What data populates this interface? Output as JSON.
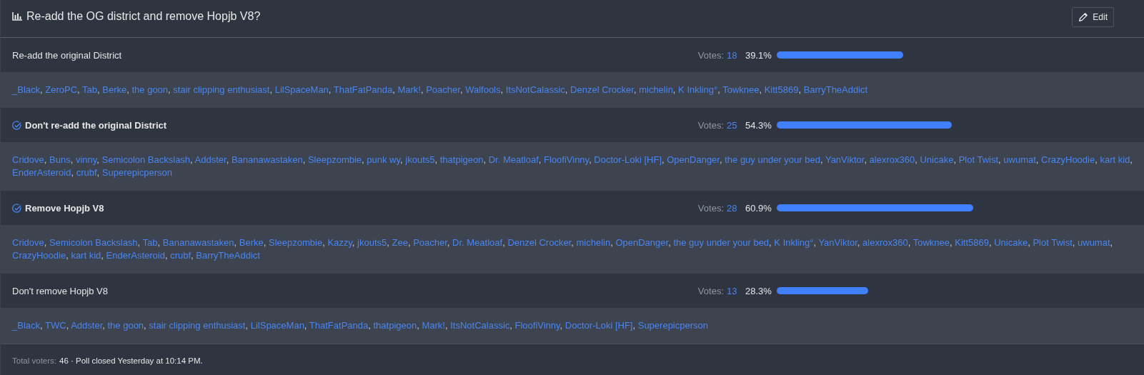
{
  "poll": {
    "title": "Re-add the OG district and remove Hopjb V8?",
    "edit_button": "Edit"
  },
  "options": [
    {
      "label": "Re-add the original District",
      "voted": false,
      "votes_label": "Votes:",
      "votes": "18",
      "percent": "39.1%",
      "voters": [
        "_Black",
        "ZeroPC",
        "Tab",
        "Berke",
        "the goon",
        "stair clipping enthusiast",
        "LilSpaceMan",
        "ThatFatPanda",
        "Mark!",
        "Poacher",
        "Walfools",
        "ItsNotCalassic",
        "Denzel Crocker",
        "michelin",
        "K Inkling°",
        "Towknee",
        "Kitt5869",
        "BarryTheAddict"
      ]
    },
    {
      "label": "Don't re-add the original District",
      "voted": true,
      "votes_label": "Votes:",
      "votes": "25",
      "percent": "54.3%",
      "voters": [
        "Cridove",
        "Buns",
        "vinny",
        "Semicolon Backslash",
        "Addster",
        "Bananawastaken",
        "Sleepzombie",
        "punk wy",
        "jkouts5",
        "thatpigeon",
        "Dr. Meatloaf",
        "FloofiVinny",
        "Doctor-Loki [HF]",
        "OpenDanger",
        "the guy under your bed",
        "YanViktor",
        "alexrox360",
        "Unicake",
        "Plot Twist",
        "uwumat",
        "CrazyHoodie",
        "kart kid",
        "EnderAsteroid",
        "crubf",
        "Superepicperson"
      ]
    },
    {
      "label": "Remove Hopjb V8",
      "voted": true,
      "votes_label": "Votes:",
      "votes": "28",
      "percent": "60.9%",
      "voters": [
        "Cridove",
        "Semicolon Backslash",
        "Tab",
        "Bananawastaken",
        "Berke",
        "Sleepzombie",
        "Kazzy",
        "jkouts5",
        "Zee",
        "Poacher",
        "Dr. Meatloaf",
        "Denzel Crocker",
        "michelin",
        "OpenDanger",
        "the guy under your bed",
        "K Inkling°",
        "YanViktor",
        "alexrox360",
        "Towknee",
        "Kitt5869",
        "Unicake",
        "Plot Twist",
        "uwumat",
        "CrazyHoodie",
        "kart kid",
        "EnderAsteroid",
        "crubf",
        "BarryTheAddict"
      ]
    },
    {
      "label": "Don't remove Hopjb V8",
      "voted": false,
      "votes_label": "Votes:",
      "votes": "13",
      "percent": "28.3%",
      "voters": [
        "_Black",
        "TWC",
        "Addster",
        "the goon",
        "stair clipping enthusiast",
        "LilSpaceMan",
        "ThatFatPanda",
        "thatpigeon",
        "Mark!",
        "ItsNotCalassic",
        "FloofiVinny",
        "Doctor-Loki [HF]",
        "Superepicperson"
      ]
    }
  ],
  "voter_separator": ",",
  "footer": {
    "total_label": "Total voters:",
    "status": "46 · Poll closed Yesterday at 10:14 PM."
  }
}
